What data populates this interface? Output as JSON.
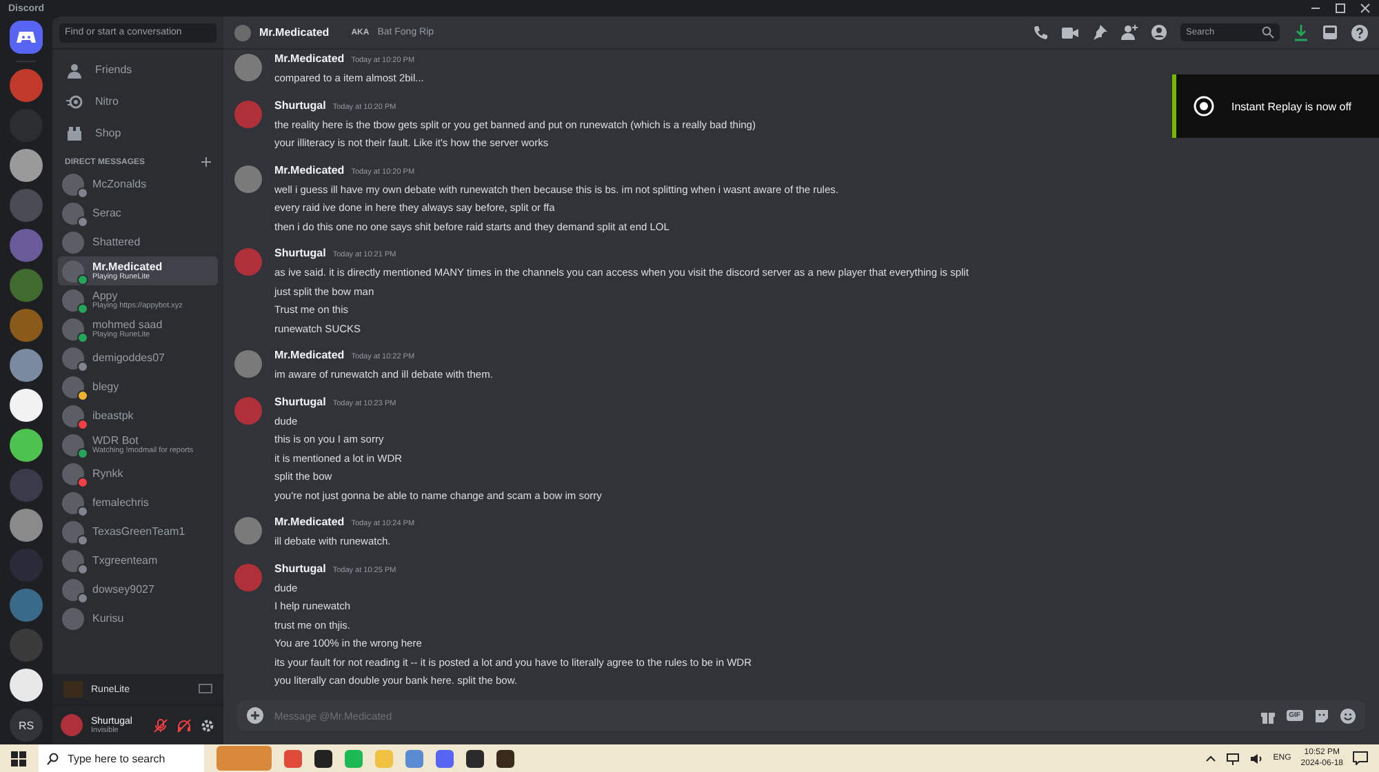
{
  "window": {
    "title": "Discord"
  },
  "servers": [
    {
      "color": "#c0392b"
    },
    {
      "color": "#2b2d31"
    },
    {
      "color": "#9a9a9a"
    },
    {
      "color": "#4a4a55"
    },
    {
      "color": "#6a5a9a"
    },
    {
      "color": "#3f6b2f"
    },
    {
      "color": "#8a5a1a"
    },
    {
      "color": "#7a8aa0"
    },
    {
      "color": "#f2f2f2"
    },
    {
      "color": "#4ec24e"
    },
    {
      "color": "#3a3a4a"
    },
    {
      "color": "#8a8a8a"
    },
    {
      "color": "#2a2a3a"
    },
    {
      "color": "#3a6a8a"
    },
    {
      "color": "#3a3a3a"
    },
    {
      "color": "#e8e8e8"
    }
  ],
  "server_initials": "RS",
  "sidebar": {
    "search": {
      "placeholder": "Find or start a conversation"
    },
    "nav": [
      {
        "label": "Friends",
        "kind": "friends"
      },
      {
        "label": "Nitro",
        "kind": "nitro"
      },
      {
        "label": "Shop",
        "kind": "shop"
      }
    ],
    "dm_heading": "DIRECT MESSAGES",
    "dms": [
      {
        "name": "McZonalds",
        "color": "#80848e",
        "selected": false
      },
      {
        "name": "Serac",
        "color": "#80848e",
        "selected": false
      },
      {
        "name": "Shattered",
        "selected": false
      },
      {
        "name": "Mr.Medicated",
        "activity": "Playing RuneLite",
        "color": "#23a55a",
        "selected": true
      },
      {
        "name": "Appy",
        "activity": "Playing https://appybot.xyz",
        "color": "#23a55a",
        "selected": false
      },
      {
        "name": "mohmed saad",
        "activity": "Playing RuneLite",
        "color": "#23a55a",
        "selected": false
      },
      {
        "name": "demigoddes07",
        "color": "#80848e",
        "selected": false
      },
      {
        "name": "blegy",
        "color": "#f0b232",
        "selected": false
      },
      {
        "name": "ibeastpk",
        "color": "#f23f43",
        "selected": false
      },
      {
        "name": "WDR Bot",
        "activity": "Watching !modmail for reports",
        "color": "#23a55a",
        "selected": false
      },
      {
        "name": "Rynkk",
        "color": "#f23f43",
        "selected": false
      },
      {
        "name": "femalechris",
        "color": "#80848e",
        "selected": false
      },
      {
        "name": "TexasGreenTeam1",
        "color": "#80848e",
        "selected": false
      },
      {
        "name": "Txgreenteam",
        "color": "#80848e",
        "selected": false
      },
      {
        "name": "dowsey9027",
        "color": "#80848e",
        "selected": false
      },
      {
        "name": "Kurisu",
        "selected": false
      }
    ]
  },
  "activity_panel": {
    "name": "RuneLite"
  },
  "user_panel": {
    "name": "Shurtugal",
    "status": "Invisible",
    "muted": true,
    "deafened": true
  },
  "header": {
    "name": "Mr.Medicated",
    "aka_label": "AKA",
    "aka": "Bat Fong Rip",
    "search": {
      "placeholder": "Search"
    }
  },
  "messages": [
    {
      "author": "Mr.Medicated",
      "time": "Today at 10:20 PM",
      "color": "#7a7a7a",
      "lines": [
        "compared to a item almost 2bil..."
      ]
    },
    {
      "author": "Shurtugal",
      "time": "Today at 10:20 PM",
      "color": "#b0303a",
      "lines": [
        "the reality here is the tbow gets split or you get banned and put on runewatch (which is a really bad thing)",
        "your illiteracy is not their fault. Like it's how the server works"
      ]
    },
    {
      "author": "Mr.Medicated",
      "time": "Today at 10:20 PM",
      "color": "#7a7a7a",
      "lines": [
        "well i guess ill have my own debate with runewatch then because this is bs. im not splitting when i wasnt aware of the rules.",
        "every raid ive done in here they always say before, split or ffa",
        "then i do this one no one says shit before raid starts and they demand split at end LOL"
      ]
    },
    {
      "author": "Shurtugal",
      "time": "Today at 10:21 PM",
      "color": "#b0303a",
      "lines": [
        "as ive said. it is directly mentioned MANY times in the channels you can access when you visit the discord server as a new player that everything is split",
        "just split the bow man",
        "Trust me on this",
        "runewatch SUCKS"
      ]
    },
    {
      "author": "Mr.Medicated",
      "time": "Today at 10:22 PM",
      "color": "#7a7a7a",
      "lines": [
        "im aware of runewatch and ill debate with them."
      ]
    },
    {
      "author": "Shurtugal",
      "time": "Today at 10:23 PM",
      "color": "#b0303a",
      "lines": [
        "dude",
        "this is on you I am sorry",
        "it is mentioned a lot in WDR",
        "split the bow",
        "you're not just gonna be able to name change and scam a bow im sorry"
      ]
    },
    {
      "author": "Mr.Medicated",
      "time": "Today at 10:24 PM",
      "color": "#7a7a7a",
      "lines": [
        "ill debate with runewatch."
      ]
    },
    {
      "author": "Shurtugal",
      "time": "Today at 10:25 PM",
      "color": "#b0303a",
      "lines": [
        "dude",
        "I help runewatch",
        "trust me on thjis.",
        "You are 100% in the wrong here",
        "its your fault for not reading it -- it is posted a lot and you have to literally agree to the rules to be in WDR",
        "you literally can double your bank here. split the bow."
      ]
    }
  ],
  "composer": {
    "placeholder": "Message @Mr.Medicated",
    "gif_label": "GIF"
  },
  "toast": {
    "text": "Instant Replay is now off"
  },
  "taskbar": {
    "search": {
      "placeholder": "Type here to search"
    },
    "apps": [
      {
        "color": "#e04a3a"
      },
      {
        "color": "#222222"
      },
      {
        "color": "#1db954"
      },
      {
        "color": "#f0c040"
      },
      {
        "color": "#5a8ad0"
      },
      {
        "color": "#5865f2"
      },
      {
        "color": "#2a2a2a"
      },
      {
        "color": "#3a2a1a"
      }
    ],
    "language": "ENG",
    "time": "10:52 PM",
    "date": "2024-06-18"
  }
}
